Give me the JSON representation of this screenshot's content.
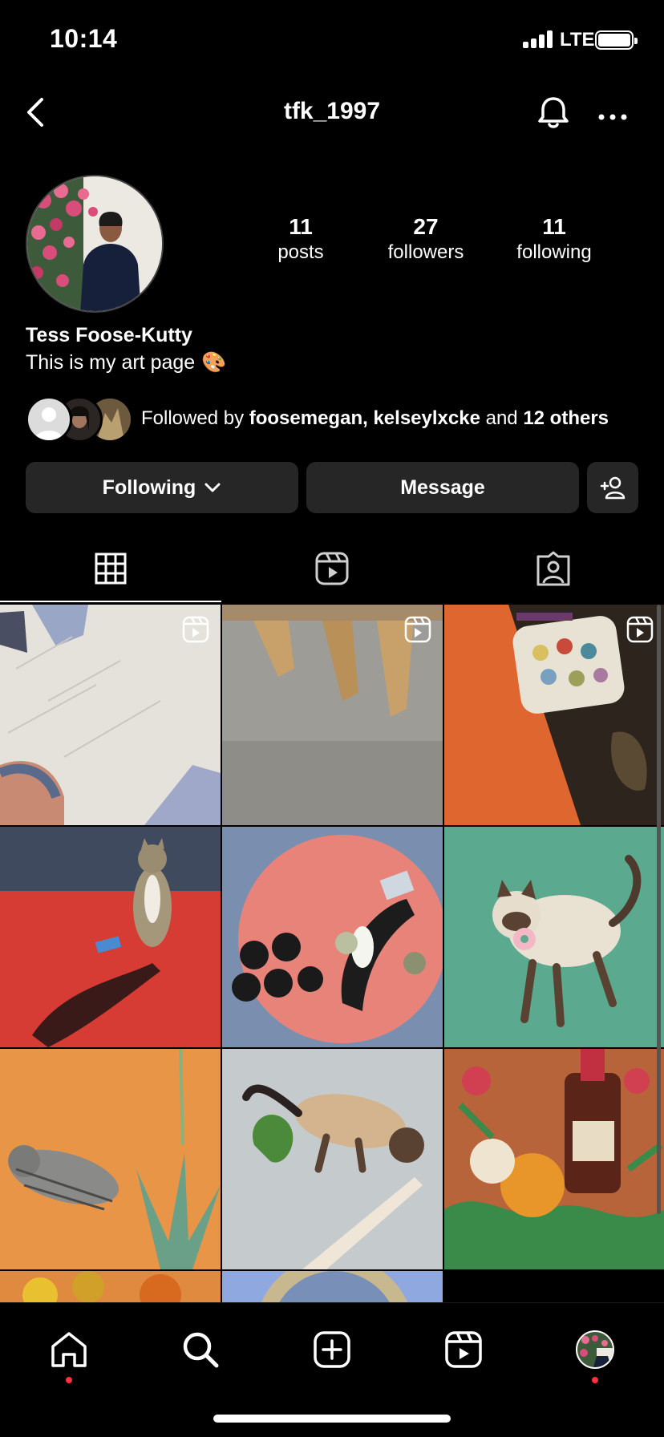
{
  "status_bar": {
    "time": "10:14",
    "network": "LTE"
  },
  "header": {
    "username": "tfk_1997"
  },
  "profile": {
    "stats": [
      {
        "value": "11",
        "label": "posts"
      },
      {
        "value": "27",
        "label": "followers"
      },
      {
        "value": "11",
        "label": "following"
      }
    ],
    "name": "Tess Foose-Kutty",
    "bio": "This is my art page",
    "bio_emoji": "🎨",
    "followed_by": {
      "prefix": "Followed by",
      "user1": "foosemegan",
      "sep": ",",
      "user2": "kelseylxcke",
      "and": "and",
      "others": "12 others"
    }
  },
  "buttons": {
    "following": "Following",
    "message": "Message"
  },
  "tabs": [
    "grid-tab",
    "reels-tab",
    "tagged-tab"
  ],
  "colors": {
    "background": "#000000",
    "button": "#262626",
    "notification_dot": "#ff3040"
  }
}
